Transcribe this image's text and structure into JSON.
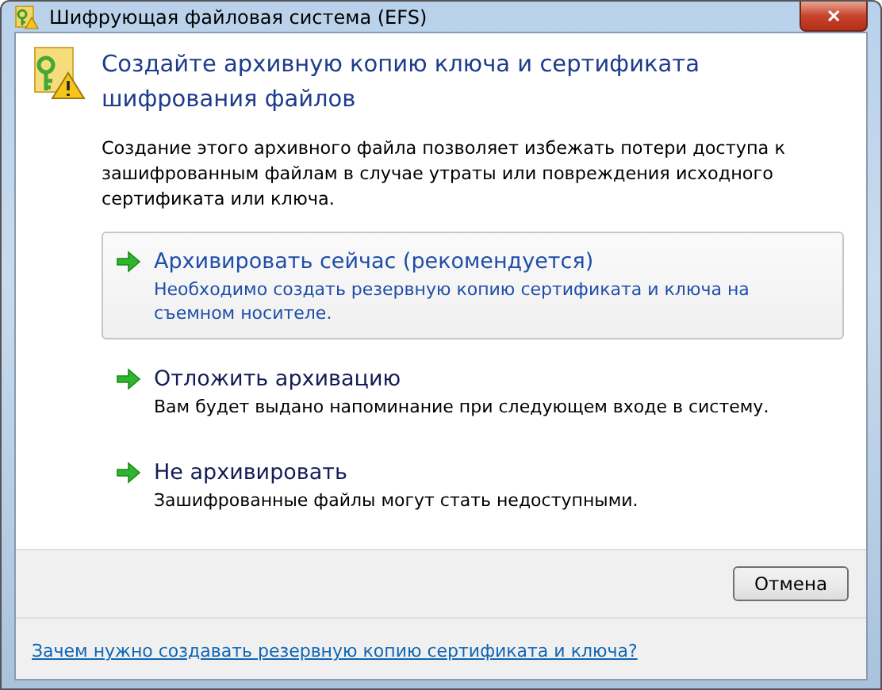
{
  "window": {
    "title": "Шифрующая файловая система (EFS)",
    "close": "✕"
  },
  "heading": "Создайте архивную копию ключа и сертификата шифрования файлов",
  "description": "Создание этого архивного файла позволяет избежать потери доступа к зашифрованным файлам в случае утраты или повреждения исходного сертификата или ключа.",
  "options": [
    {
      "title": "Архивировать сейчас (рекомендуется)",
      "note": "Необходимо создать резервную копию сертификата и ключа на съемном носителе.",
      "selected": true
    },
    {
      "title": "Отложить архивацию",
      "note": "Вам будет выдано напоминание при следующем входе в систему.",
      "selected": false
    },
    {
      "title": "Не архивировать",
      "note": "Зашифрованные файлы могут стать недоступными.",
      "selected": false
    }
  ],
  "buttons": [
    "Отмена"
  ],
  "help_link": "Зачем нужно создавать резервную копию сертификата и ключа?"
}
